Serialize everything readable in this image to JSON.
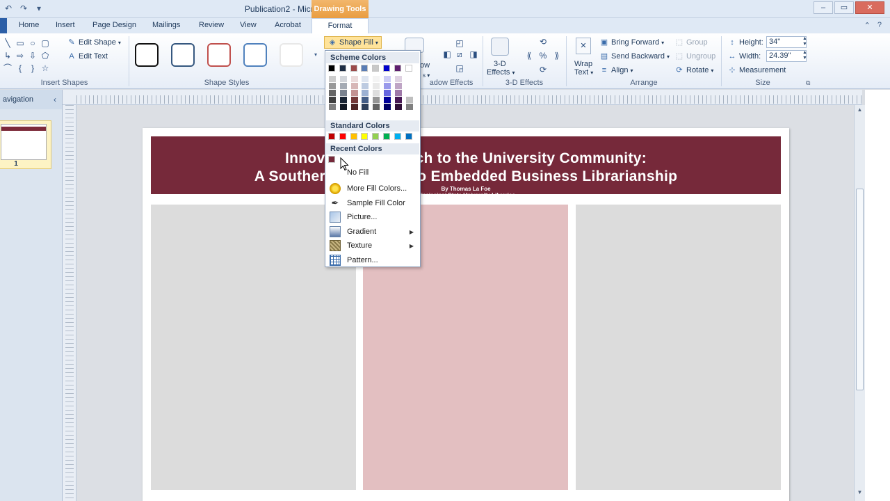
{
  "window": {
    "title": "Publication2  -  Microsoft Publisher",
    "contextual_tab": "Drawing Tools",
    "controls": [
      "–",
      "▭",
      "✕"
    ]
  },
  "tabs": [
    "Home",
    "Insert",
    "Page Design",
    "Mailings",
    "Review",
    "View",
    "Acrobat"
  ],
  "active_tab": "Format",
  "ribbon": {
    "insert_shapes": {
      "label": "Insert Shapes",
      "edit_shape": "Edit Shape",
      "edit_text": "Edit Text"
    },
    "shape_styles": {
      "label": "Shape Styles"
    },
    "shape_fill": "Shape Fill",
    "shadow_effects": {
      "label": "adow Effects",
      "partial_button": "ow"
    },
    "effects_3d": {
      "label": "3-D Effects",
      "button_line1": "3-D",
      "button_line2": "Effects"
    },
    "arrange": {
      "label": "Arrange",
      "wrap_text_line1": "Wrap",
      "wrap_text_line2": "Text",
      "bring_forward": "Bring Forward",
      "send_backward": "Send Backward",
      "align": "Align",
      "group": "Group",
      "ungroup": "Ungroup",
      "rotate": "Rotate"
    },
    "size": {
      "label": "Size",
      "height_label": "Height:",
      "height_value": "34\"",
      "width_label": "Width:",
      "width_value": "24.39\"",
      "measurement": "Measurement"
    }
  },
  "nav_pane": {
    "title": "avigation",
    "page_number": "1"
  },
  "publication": {
    "title_line1": "Innovative Approach to the University Community:",
    "title_line2": "A Southern Approach to Embedded Business Librarianship",
    "author": "By Thomas La Foe",
    "affiliation": "Mississippi State University Libraries",
    "banner_color": "#76293a",
    "middle_column_color": "#e3bfc1"
  },
  "shape_fill_menu": {
    "scheme_colors_label": "Scheme Colors",
    "standard_colors_label": "Standard Colors",
    "recent_colors_label": "Recent Colors",
    "scheme_colors": [
      "#000000",
      "#1f2e44",
      "#9b4a4a",
      "#5a7db5",
      "#c8c8c8",
      "#0000cc",
      "#5e1e6e",
      "#ffffff"
    ],
    "standard_colors": [
      "#c00000",
      "#ff0000",
      "#ffc000",
      "#ffff00",
      "#92d050",
      "#00b050",
      "#00b0f0",
      "#0070c0"
    ],
    "recent_colors": [
      "#76293a"
    ],
    "items": [
      {
        "label": "No Fill",
        "icon": "no-fill-icon",
        "has_submenu": false
      },
      {
        "label": "More Fill Colors...",
        "icon": "color-palette-icon",
        "has_submenu": false
      },
      {
        "label": "Sample Fill Color",
        "icon": "eyedropper-icon",
        "has_submenu": false
      },
      {
        "label": "Picture...",
        "icon": "picture-icon",
        "has_submenu": false
      },
      {
        "label": "Gradient",
        "icon": "gradient-icon",
        "has_submenu": true
      },
      {
        "label": "Texture",
        "icon": "texture-icon",
        "has_submenu": true
      },
      {
        "label": "Pattern...",
        "icon": "pattern-icon",
        "has_submenu": false
      }
    ]
  }
}
